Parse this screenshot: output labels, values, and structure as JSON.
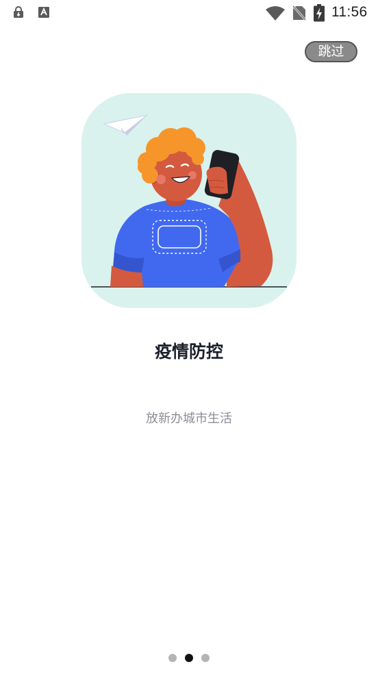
{
  "status_bar": {
    "time": "11:56",
    "icons": [
      "lock-download-icon",
      "keyboard-a-icon",
      "wifi-icon",
      "no-sim-icon",
      "battery-charging-icon"
    ]
  },
  "skip_button": {
    "label": "跳过"
  },
  "onboarding": {
    "title": "疫情防控",
    "subtitle": "放新办城市生活",
    "illustration": "person-with-phone-illustration"
  },
  "pager": {
    "total_pages": 3,
    "current_page": 2
  },
  "colors": {
    "illustration_bg": "#d9f2ee",
    "shirt": "#4169f0",
    "skin": "#d45a3f",
    "hair": "#f6962a",
    "title_text": "#1d1f2b",
    "subtitle_text": "#8b8d96",
    "skip_button_bg": "#8a8a8a"
  }
}
